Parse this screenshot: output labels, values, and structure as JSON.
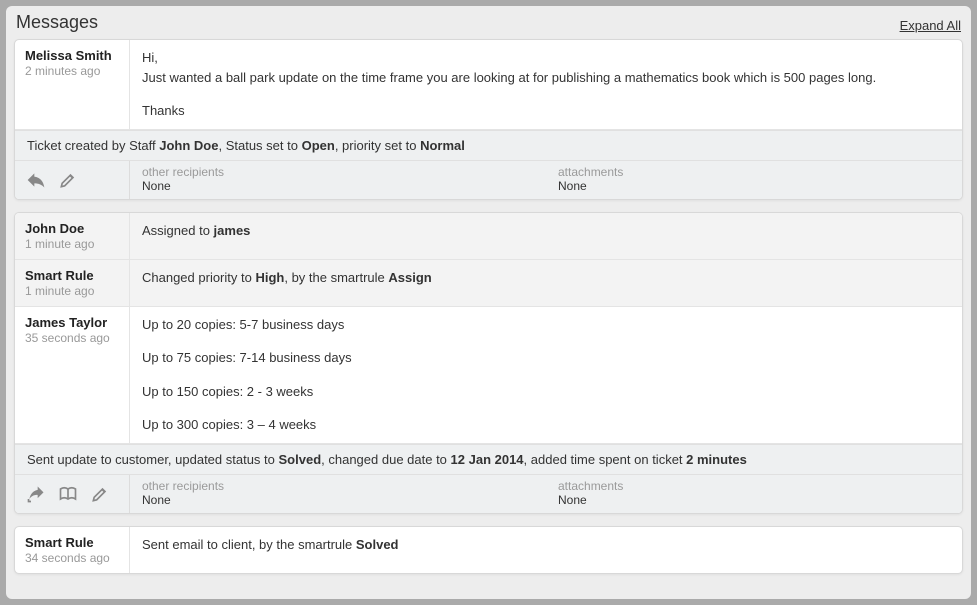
{
  "header": {
    "title": "Messages",
    "expand_all": "Expand All"
  },
  "labels": {
    "other_recipients": "other recipients",
    "attachments": "attachments",
    "none": "None"
  },
  "card1": {
    "msg1": {
      "author": "Melissa Smith",
      "time": "2 minutes ago",
      "line1": "Hi,",
      "line2": "Just wanted a ball park update on the time frame you are looking at for publishing a mathematics book which is 500 pages long.",
      "line3": "Thanks"
    },
    "audit": {
      "pre": "Ticket created by Staff ",
      "staff": "John Doe",
      "mid1": ", Status set to ",
      "status": "Open",
      "mid2": ", priority set to ",
      "priority": "Normal"
    },
    "footer": {
      "other_recipients_value": "None",
      "attachments_value": "None"
    }
  },
  "card2": {
    "row1": {
      "author": "John Doe",
      "time": "1 minute ago",
      "pre": "Assigned to ",
      "who": "james"
    },
    "row2": {
      "author": "Smart Rule",
      "time": "1 minute ago",
      "pre": "Changed priority to ",
      "priority": "High",
      "mid": ", by the smartrule ",
      "rule": "Assign"
    },
    "row3": {
      "author": "James Taylor",
      "time": "35 seconds ago",
      "l1": "Up to 20 copies: 5-7 business days",
      "l2": "Up to 75 copies: 7-14 business days",
      "l3": "Up to 150 copies: 2 - 3 weeks",
      "l4": "Up to 300 copies: 3 – 4 weeks"
    },
    "audit": {
      "pre": "Sent update to customer, updated status to ",
      "status": "Solved",
      "mid1": ", changed due date to ",
      "date": "12 Jan 2014",
      "mid2": ", added time spent on ticket ",
      "time": "2 minutes"
    },
    "footer": {
      "other_recipients_value": "None",
      "attachments_value": "None"
    }
  },
  "card3": {
    "row1": {
      "author": "Smart Rule",
      "time": "34 seconds ago",
      "pre": "Sent email to client, by the smartrule ",
      "rule": "Solved"
    }
  }
}
